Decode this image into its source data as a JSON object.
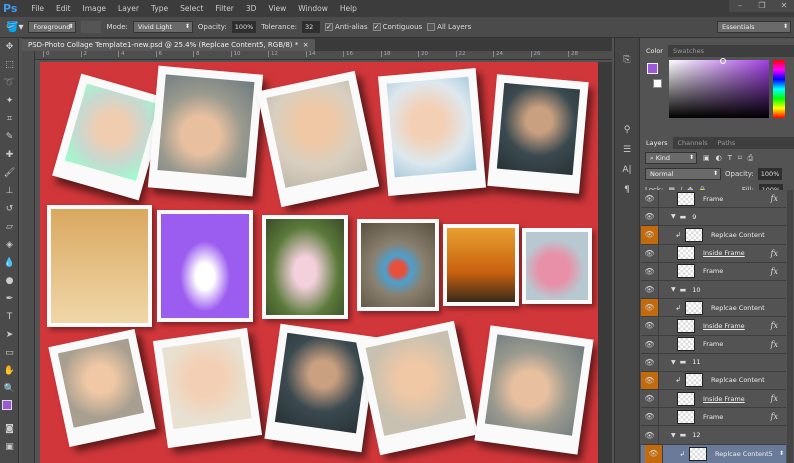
{
  "app": {
    "logo": "Ps"
  },
  "menu": [
    "File",
    "Edit",
    "Image",
    "Layer",
    "Type",
    "Select",
    "Filter",
    "3D",
    "View",
    "Window",
    "Help"
  ],
  "window_controls": [
    "–",
    "❐",
    "✕"
  ],
  "options": {
    "fill_source": "Foreground",
    "mode_label": "Mode:",
    "mode": "Vivid Light",
    "opacity_label": "Opacity:",
    "opacity": "100%",
    "tolerance_label": "Tolerance:",
    "tolerance": "32",
    "antialias": "Anti-alias",
    "contiguous": "Contiguous",
    "all_layers": "All Layers",
    "workspace": "Essentials"
  },
  "document": {
    "tab_title": "PSD-Photo Collage Template1-new.psd @ 25.4% (Replcae Content5, RGB/8) *",
    "close": "×",
    "ruler_ticks": [
      "0",
      "2",
      "4",
      "6",
      "8",
      "10",
      "12",
      "14",
      "16",
      "18",
      "20",
      "22",
      "24",
      "26",
      "28"
    ]
  },
  "color_panel": {
    "tabs": [
      "Color",
      "Swatches"
    ],
    "foreground": "#9b59d9",
    "background": "#ffffff"
  },
  "layers_panel": {
    "tabs": [
      "Layers",
      "Channels",
      "Paths"
    ],
    "filter": "Kind",
    "blend_mode": "Normal",
    "opacity_label": "Opacity:",
    "opacity": "100%",
    "lock_label": "Lock:",
    "fill_label": "Fill:",
    "fill": "100%",
    "rows": [
      {
        "type": "layer",
        "name": "Frame",
        "fx": "fx"
      },
      {
        "type": "group",
        "name": "9"
      },
      {
        "type": "clip",
        "name": "Replcae Content"
      },
      {
        "type": "layer",
        "name": "Inside Frame",
        "fx": "fx",
        "underline": true
      },
      {
        "type": "layer",
        "name": "Frame",
        "fx": "fx"
      },
      {
        "type": "group",
        "name": "10"
      },
      {
        "type": "clip",
        "name": "Replcae Content"
      },
      {
        "type": "layer",
        "name": "Inside Frame",
        "fx": "fx",
        "underline": true
      },
      {
        "type": "layer",
        "name": "Frame",
        "fx": "fx"
      },
      {
        "type": "group",
        "name": "11"
      },
      {
        "type": "clip",
        "name": "Replcae Content"
      },
      {
        "type": "layer",
        "name": "Inside Frame",
        "fx": "fx",
        "underline": true
      },
      {
        "type": "layer",
        "name": "Frame",
        "fx": "fx"
      },
      {
        "type": "group",
        "name": "12"
      },
      {
        "type": "clip",
        "name": "Replcae Content5",
        "selected": true
      }
    ]
  },
  "colors": {
    "canvas": "#d1373a",
    "accent_eye": "#c26a0c",
    "selected_row": "#6a7b99"
  }
}
